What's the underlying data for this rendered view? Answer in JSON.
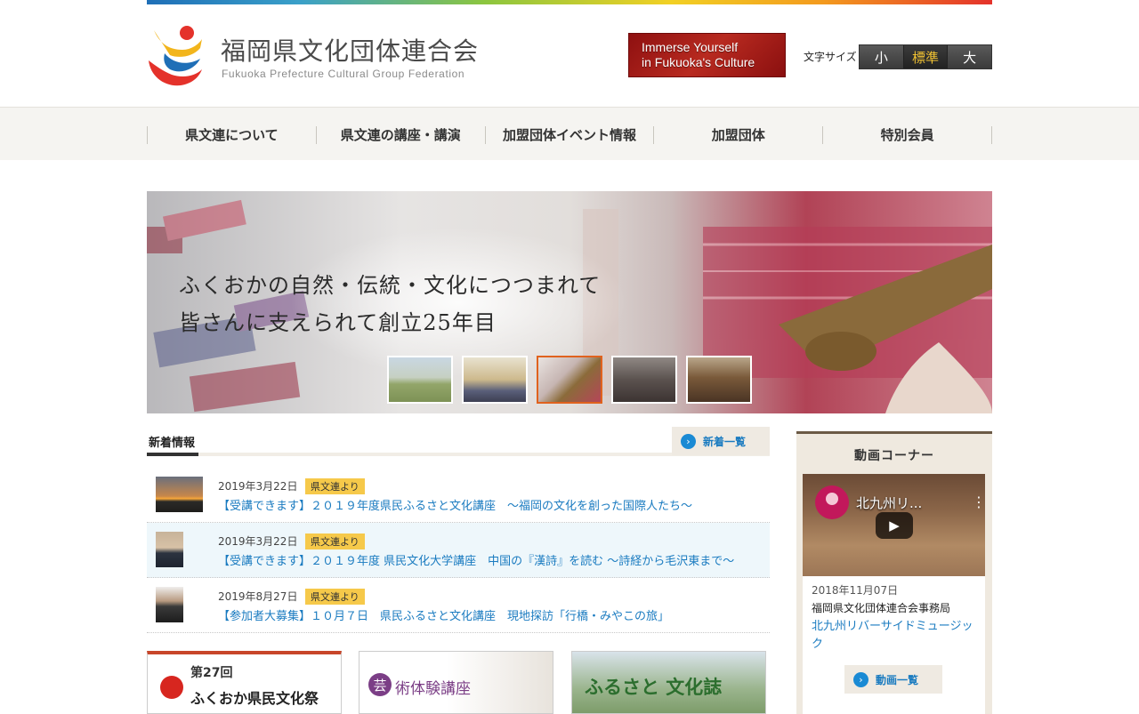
{
  "header": {
    "logo_jp": "福岡県文化団体連合会",
    "logo_en": "Fukuoka Prefecture Cultural Group Federation",
    "immerse_line1": "Immerse Yourself",
    "immerse_line2": "in Fukuoka's Culture",
    "font_size_label": "文字サイズ",
    "font_sizes": [
      "小",
      "標準",
      "大"
    ],
    "font_size_selected": "標準"
  },
  "nav": {
    "items": [
      "県文連について",
      "県文連の講座・講演",
      "加盟団体イベント情報",
      "加盟団体",
      "特別会員"
    ]
  },
  "slider": {
    "catch_line1": "ふくおかの自然・伝統・文化につつまれて",
    "catch_line2": "皆さんに支えられて創立25年目",
    "active_thumb_index": 2
  },
  "news": {
    "title": "新着情報",
    "more_label": "新着一覧",
    "items": [
      {
        "date": "2019年3月22日",
        "badge": "県文連より",
        "title": "【受講できます】２０１９年度県民ふるさと文化講座　～福岡の文化を創った国際人たち～"
      },
      {
        "date": "2019年3月22日",
        "badge": "県文連より",
        "title": "【受講できます】２０１９年度 県民文化大学講座　中国の『漢詩』を読む ～詩経から毛沢東まで～"
      },
      {
        "date": "2019年8月27日",
        "badge": "県文連より",
        "title": "【参加者大募集】１０月７日　県民ふるさと文化講座　現地探訪「行橋・みやこの旅」"
      }
    ]
  },
  "banners": {
    "festival_num": "第27回",
    "festival_text": "ふくおか県民文化祭",
    "art_circle": "芸",
    "art_text": "術体験講座",
    "furusato_text": "ふるさと 文化誌"
  },
  "video": {
    "title": "動画コーナー",
    "caption": "北九州リ...",
    "date": "2018年11月07日",
    "org": "福岡県文化団体連合会事務局",
    "link": "北九州リバーサイドミュージック",
    "more_label": "動画一覧"
  },
  "colors": {
    "accent_blue": "#1a7bc0",
    "badge_yellow": "#f6c94a",
    "immerse_red": "#a51d18"
  }
}
